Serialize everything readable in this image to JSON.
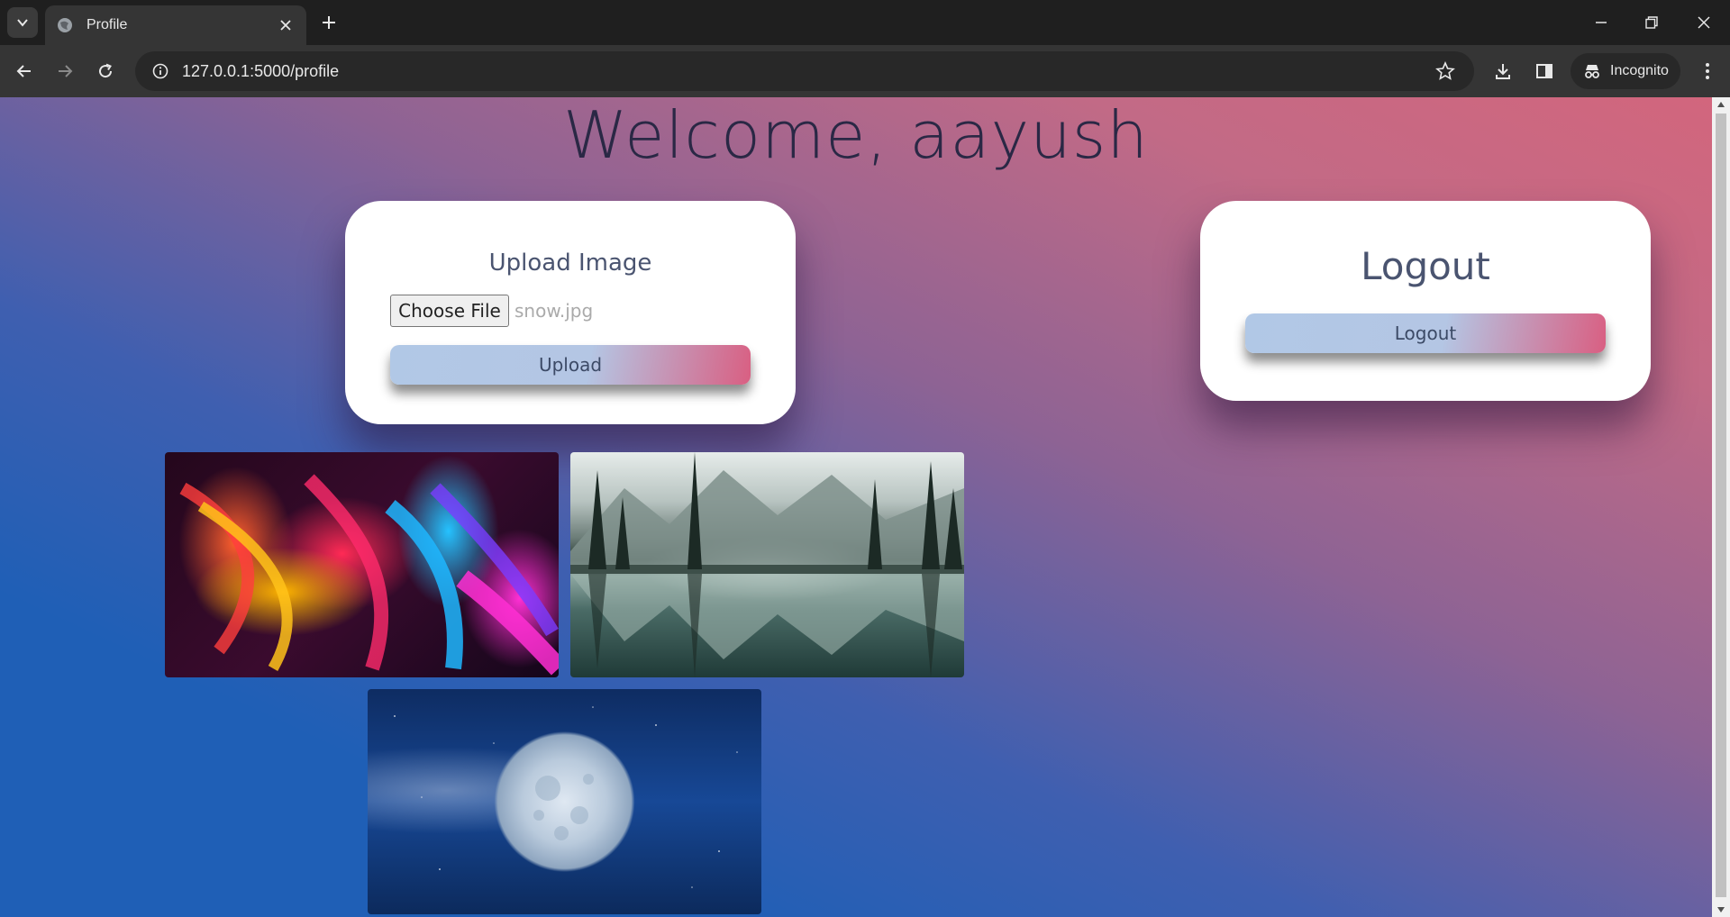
{
  "browser": {
    "tab_title": "Profile",
    "url": "127.0.0.1:5000/profile",
    "incognito_label": "Incognito"
  },
  "page": {
    "welcome": "Welcome, aayush",
    "upload_card": {
      "heading": "Upload Image",
      "choose_file_label": "Choose File",
      "file_name": "snow.jpg",
      "upload_button": "Upload"
    },
    "logout_card": {
      "heading": "Logout",
      "logout_button": "Logout"
    },
    "gallery": [
      {
        "name": "abstract-fluid-art-image"
      },
      {
        "name": "mountain-lake-image"
      },
      {
        "name": "moon-image"
      }
    ]
  },
  "colors": {
    "gradient_top": "#d2667d",
    "gradient_bottom": "#1f5fb6",
    "button_start": "#b1c8e6",
    "button_end": "#d95f82"
  }
}
